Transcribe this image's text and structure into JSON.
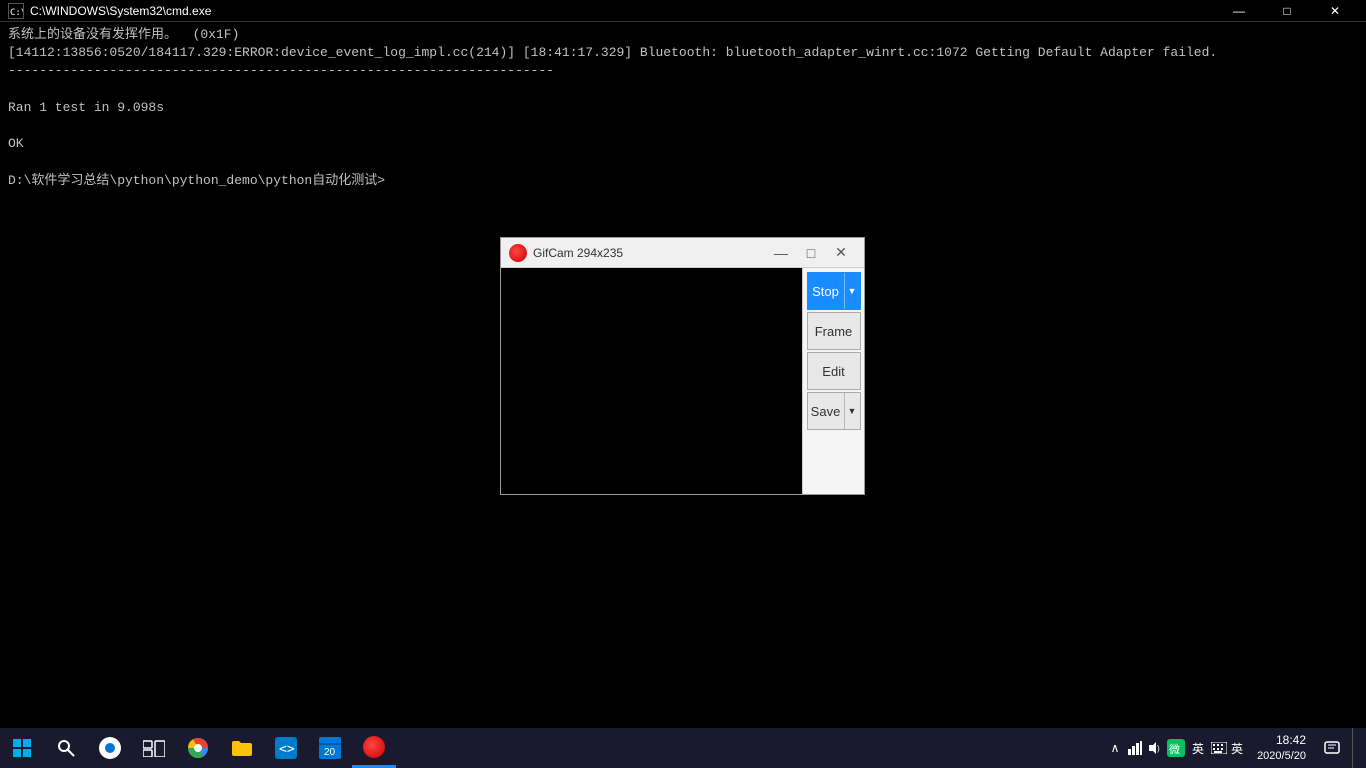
{
  "cmd": {
    "titlebar": {
      "title": "C:\\WINDOWS\\System32\\cmd.exe",
      "minimize_label": "—",
      "maximize_label": "□",
      "close_label": "✕"
    },
    "content_lines": [
      "系统上的设备没有发挥作用。  (0x1F)",
      "[14112:13856:0520/184117.329:ERROR:device_event_log_impl.cc(214)] [18:41:17.329] Bluetooth: bluetooth_adapter_winrt.cc:1072 Getting Default Adapter failed.",
      "----------------------------------------------------------------------",
      "",
      "Ran 1 test in 9.098s",
      "",
      "OK",
      "",
      "D:\\软件学习总结\\python\\python_demo\\python自动化测试>"
    ]
  },
  "gifcam": {
    "titlebar": {
      "title": "GifCam 294x235",
      "minimize_label": "—",
      "maximize_label": "□",
      "close_label": "✕"
    },
    "buttons": {
      "stop": "Stop",
      "frame": "Frame",
      "edit": "Edit",
      "save": "Save"
    },
    "counter_text": ""
  },
  "taskbar": {
    "start_icon": "⊞",
    "tray": {
      "chevron": "∧",
      "network": "🌐",
      "volume": "🔊",
      "ime": "英",
      "keyboard": "⌨",
      "time": "18:42",
      "date": "2020/5/20",
      "notification": "🔔"
    },
    "apps": [
      {
        "name": "start",
        "icon": "windows"
      },
      {
        "name": "search",
        "icon": "search"
      },
      {
        "name": "cortana",
        "icon": "cortana"
      },
      {
        "name": "taskview",
        "icon": "taskview"
      },
      {
        "name": "chrome",
        "icon": "chrome"
      },
      {
        "name": "folder",
        "icon": "folder"
      },
      {
        "name": "vscode",
        "icon": "vscode"
      },
      {
        "name": "calendar",
        "icon": "calendar"
      },
      {
        "name": "gifcam",
        "icon": "gifcam"
      }
    ]
  }
}
